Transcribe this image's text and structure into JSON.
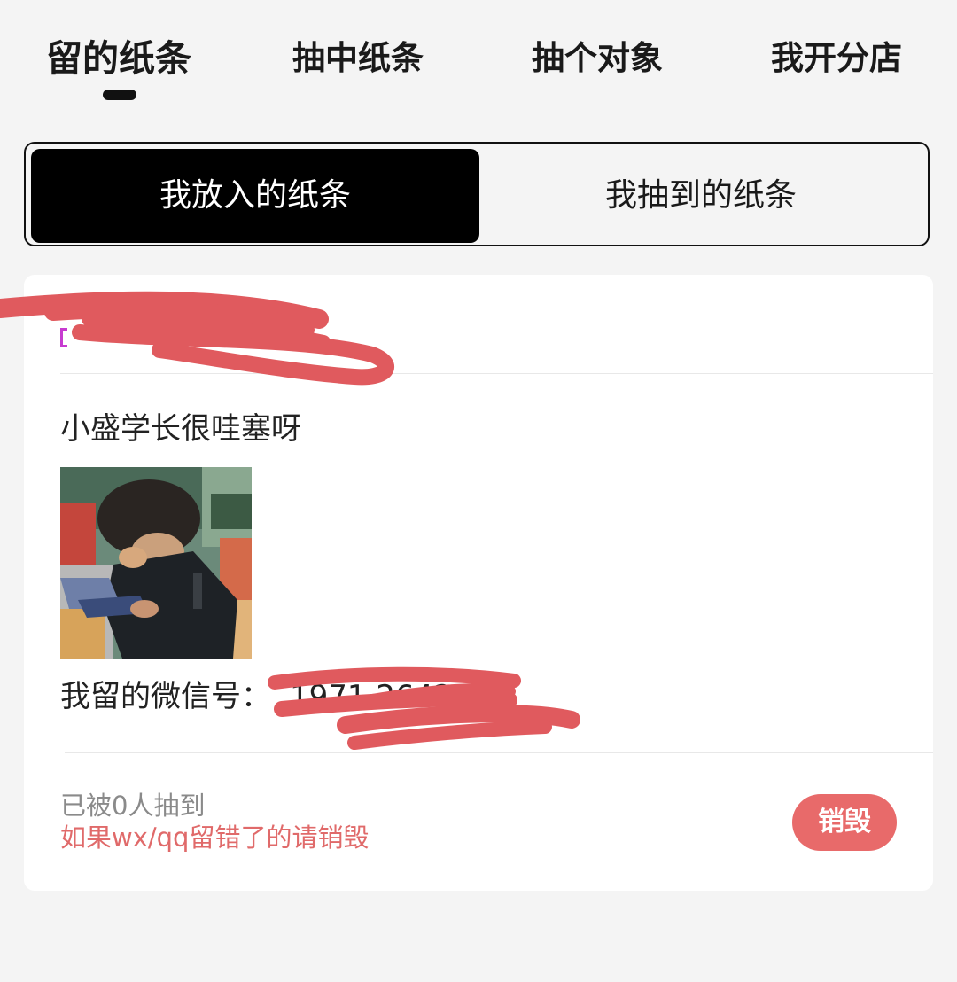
{
  "top_tabs": [
    {
      "label": "留的纸条",
      "active": true
    },
    {
      "label": "抽中纸条",
      "active": false
    },
    {
      "label": "抽个对象",
      "active": false
    },
    {
      "label": "我开分店",
      "active": false
    }
  ],
  "segment": {
    "active_label": "我放入的纸条",
    "inactive_label": "我抽到的纸条"
  },
  "card": {
    "note_text": "小盛学长很哇塞呀",
    "wechat_label": "我留的微信号：",
    "wechat_value": "1971  264235",
    "draw_count_text": "已被0人抽到",
    "hint_text": "如果wx/qq留错了的请销毁",
    "destroy_label": "销毁"
  },
  "colors": {
    "accent_red": "#e86a6a",
    "hint_red": "#e06a6a",
    "active_segment": "#000000",
    "background": "#f4f4f4",
    "redaction": "#e05a5e"
  }
}
